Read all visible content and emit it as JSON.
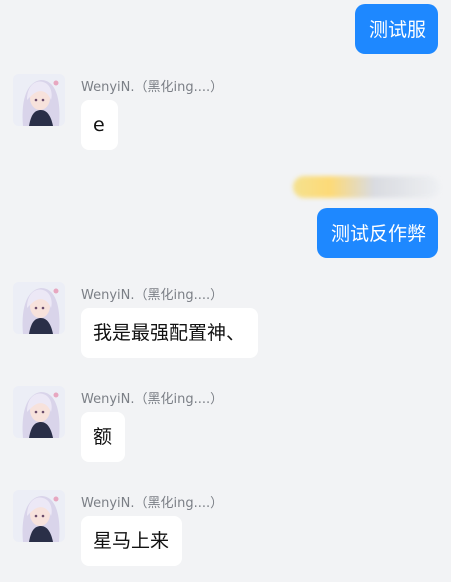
{
  "messages": {
    "out1": "测试服",
    "out2": "测试反作弊",
    "in1": {
      "sender": "WenyiN.（黑化ing....）",
      "text": "e"
    },
    "in2": {
      "sender": "WenyiN.（黑化ing....）",
      "text": "我是最强配置神、"
    },
    "in3": {
      "sender": "WenyiN.（黑化ing....）",
      "text": "额"
    },
    "in4": {
      "sender": "WenyiN.（黑化ing....）",
      "text": "星马上来"
    }
  },
  "colors": {
    "background": "#f2f3f5",
    "outgoing_bubble": "#1e88ff",
    "incoming_bubble": "#ffffff",
    "sender_name": "#7b7f86"
  },
  "icons": {
    "avatar": "anime-girl-avatar-icon"
  }
}
